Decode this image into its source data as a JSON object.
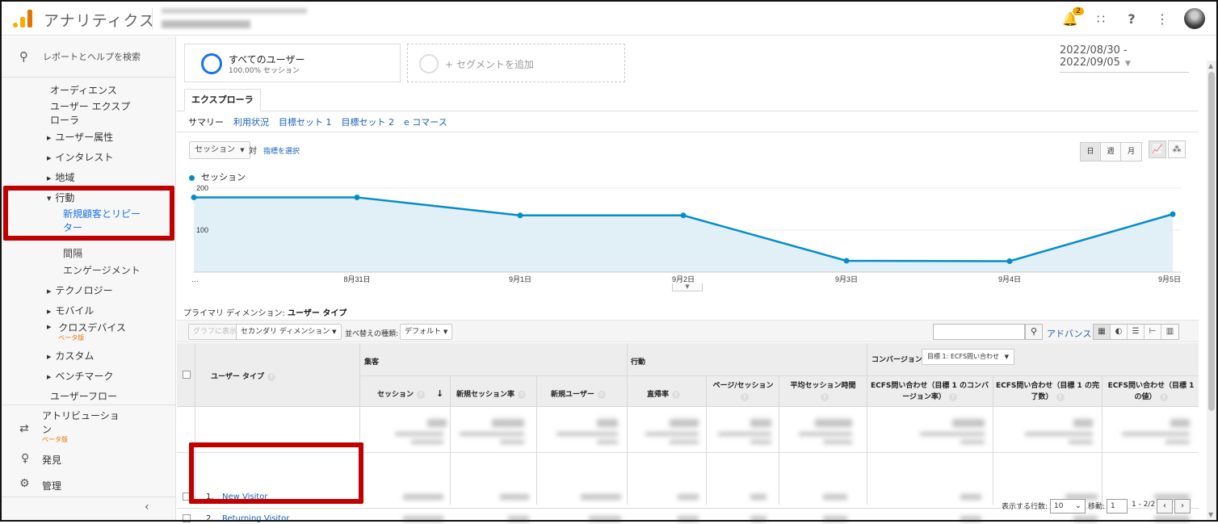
{
  "header": {
    "app_title": "アナリティクス",
    "notification_count": "2",
    "icons": [
      "bell-icon",
      "apps-icon",
      "help-icon",
      "more-vert-icon",
      "avatar"
    ]
  },
  "sidebar": {
    "search_placeholder": "レポートとヘルプを検索",
    "audience": "オーディエンス",
    "user_explorer_1": "ユーザー エクスプ",
    "user_explorer_2": "ローラ",
    "demographics": "ユーザー属性",
    "interests": "インタレスト",
    "geo": "地域",
    "behavior": "行動",
    "new_vs_returning_1": "新規顧客とリピー",
    "new_vs_returning_2": "ター",
    "frequency": "間隔",
    "engagement": "エンゲージメント",
    "technology": "テクノロジー",
    "mobile": "モバイル",
    "cross_device": "クロスデバイス",
    "cross_device_beta": "ベータ版",
    "custom": "カスタム",
    "benchmark": "ベンチマーク",
    "user_flow": "ユーザーフロー",
    "attribution_1": "アトリビューショ",
    "attribution_2": "ン",
    "attribution_beta": "ベータ版",
    "discover": "発見",
    "admin": "管理",
    "collapse": "‹"
  },
  "segments": {
    "all_users": "すべてのユーザー",
    "all_users_sub": "100.00% セッション",
    "add_segment": "+ セグメントを追加"
  },
  "date_range": "2022/08/30 - 2022/09/05",
  "tabs": {
    "explorer": "エクスプローラ",
    "subtabs": [
      "サマリー",
      "利用状況",
      "目標セット 1",
      "目標セット 2",
      "e コマース"
    ]
  },
  "chart_controls": {
    "metric": "セッション",
    "vs": "対",
    "pick_metric": "指標を選択",
    "periods": [
      "日",
      "週",
      "月"
    ]
  },
  "chart_data": {
    "type": "area",
    "series": [
      {
        "name": "セッション",
        "values": [
          178,
          178,
          135,
          135,
          27,
          26,
          138
        ]
      }
    ],
    "x": [
      "…",
      "8月31日",
      "9月1日",
      "9月2日",
      "9月3日",
      "9月4日",
      "9月5日"
    ],
    "y_ticks": [
      "200",
      "100"
    ],
    "ylim": [
      0,
      200
    ],
    "color": "#058dc7",
    "fill": "#e1eff7",
    "grid": true,
    "legend": "top-left"
  },
  "table": {
    "primary_dimension_label": "プライマリ ディメンション:",
    "primary_dimension": "ユーザー タイプ",
    "toolbar": {
      "plot_rows": "グラフに表示",
      "secondary_dimension": "セカンダリ ディメンション",
      "sort_type_label": "並べ替えの種類:",
      "sort_type": "デフォルト",
      "advanced": "アドバンス"
    },
    "group_headers": {
      "acquisition": "集客",
      "behavior": "行動",
      "conversion": "コンバージョン",
      "goal_select": "目標 1: ECFS問い合わせ"
    },
    "dimension_header": "ユーザー タイプ",
    "columns": [
      "セッション",
      "新規セッション率",
      "新規ユーザー",
      "直帰率",
      "ページ/セッション",
      "平均セッション時間",
      "ECFS問い合わせ（目標 1 のコンバージョン率）",
      "ECFS問い合わせ（目標 1 の完了数）",
      "ECFS問い合わせ（目標 1 の値）"
    ],
    "rows": [
      {
        "num": "1.",
        "label": "New Visitor"
      },
      {
        "num": "2.",
        "label": "Returning Visitor"
      }
    ],
    "pager": {
      "rows_label": "表示する行数:",
      "rows_value": "10",
      "goto_label": "移動:",
      "goto_value": "1",
      "range": "1 - 2/2"
    }
  }
}
